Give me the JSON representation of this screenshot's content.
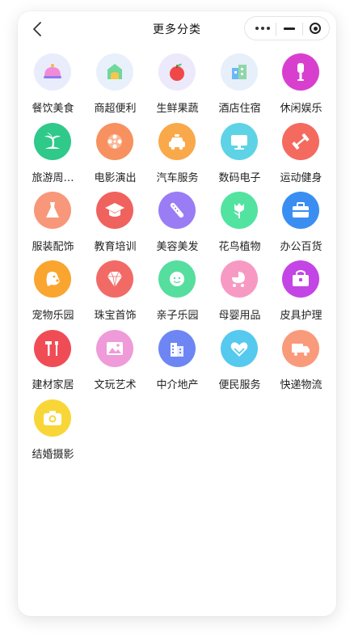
{
  "navbar": {
    "title": "更多分类",
    "back_icon": "chevron-left-icon",
    "capsule": {
      "more_icon": "more-dots-icon",
      "minimize_icon": "minimize-icon",
      "close_icon": "target-close-icon"
    }
  },
  "categories": [
    {
      "label": "餐饮美食",
      "icon": "cloche-icon"
    },
    {
      "label": "商超便利",
      "icon": "store-icon"
    },
    {
      "label": "生鲜果蔬",
      "icon": "apple-icon"
    },
    {
      "label": "酒店住宿",
      "icon": "hotel-icon"
    },
    {
      "label": "休闲娱乐",
      "icon": "microphone-icon"
    },
    {
      "label": "旅游周…",
      "icon": "palm-tree-icon"
    },
    {
      "label": "电影演出",
      "icon": "film-reel-icon"
    },
    {
      "label": "汽车服务",
      "icon": "car-icon"
    },
    {
      "label": "数码电子",
      "icon": "monitor-icon"
    },
    {
      "label": "运动健身",
      "icon": "dumbbell-icon"
    },
    {
      "label": "服装配饰",
      "icon": "dress-icon"
    },
    {
      "label": "教育培训",
      "icon": "graduation-cap-icon"
    },
    {
      "label": "美容美发",
      "icon": "comb-icon"
    },
    {
      "label": "花鸟植物",
      "icon": "tulip-icon"
    },
    {
      "label": "办公百货",
      "icon": "briefcase-icon"
    },
    {
      "label": "宠物乐园",
      "icon": "dog-icon"
    },
    {
      "label": "珠宝首饰",
      "icon": "diamond-icon"
    },
    {
      "label": "亲子乐园",
      "icon": "baby-face-icon"
    },
    {
      "label": "母婴用品",
      "icon": "stroller-icon"
    },
    {
      "label": "皮具护理",
      "icon": "handbag-icon"
    },
    {
      "label": "建材家居",
      "icon": "tools-icon"
    },
    {
      "label": "文玩艺术",
      "icon": "picture-icon"
    },
    {
      "label": "中介地产",
      "icon": "building-icon"
    },
    {
      "label": "便民服务",
      "icon": "heart-hands-icon"
    },
    {
      "label": "快递物流",
      "icon": "truck-icon"
    },
    {
      "label": "结婚摄影",
      "icon": "camera-icon"
    }
  ],
  "colors": {
    "cloche-icon": "#e9ecfb",
    "store-icon": "#e8f0fb",
    "apple-icon": "#ece9fb",
    "hotel-icon": "#e6effa",
    "microphone-icon": "#d93fcf",
    "palm-tree-icon": "#2fc98a",
    "film-reel-icon": "#f7915f",
    "car-icon": "#f9a94a",
    "monitor-icon": "#5fd3e6",
    "dumbbell-icon": "#f46a5f",
    "dress-icon": "#f8977a",
    "graduation-cap-icon": "#f0625d",
    "comb-icon": "#9a7cf4",
    "tulip-icon": "#52e3a0",
    "briefcase-icon": "#3a8ef2",
    "dog-icon": "#f9a52f",
    "diamond-icon": "#f26a66",
    "baby-face-icon": "#55de9e",
    "stroller-icon": "#f79ac3",
    "handbag-icon": "#c345e6",
    "tools-icon": "#f04c56",
    "picture-icon": "#ef9ad9",
    "building-icon": "#6e86f4",
    "heart-hands-icon": "#56c9ef",
    "truck-icon": "#f99a7b",
    "camera-icon": "#f9d637"
  }
}
